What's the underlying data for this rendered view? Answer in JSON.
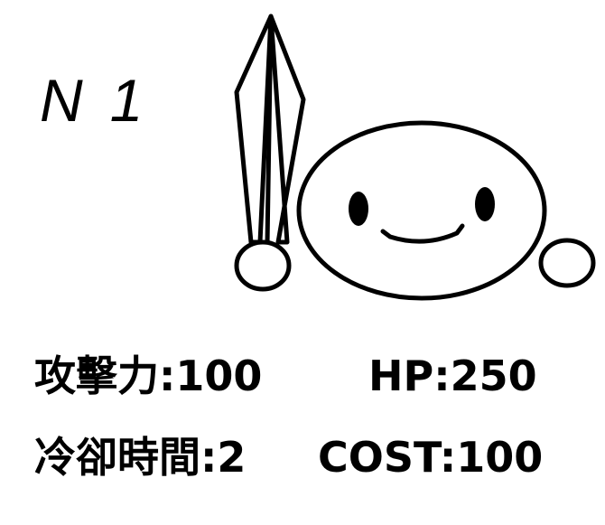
{
  "card": {
    "rank": "N",
    "number": "1"
  },
  "stats": {
    "attack_label": "攻擊力:",
    "attack_value": "100",
    "hp_label": "HP:",
    "hp_value": "250",
    "cooldown_label": "冷卻時間:",
    "cooldown_value": "2",
    "cost_label": "COST:",
    "cost_value": "100"
  },
  "art": {
    "icons": [
      "sword-icon",
      "slime-character-icon"
    ],
    "stroke_color": "#000000",
    "fill_color": "#ffffff"
  }
}
